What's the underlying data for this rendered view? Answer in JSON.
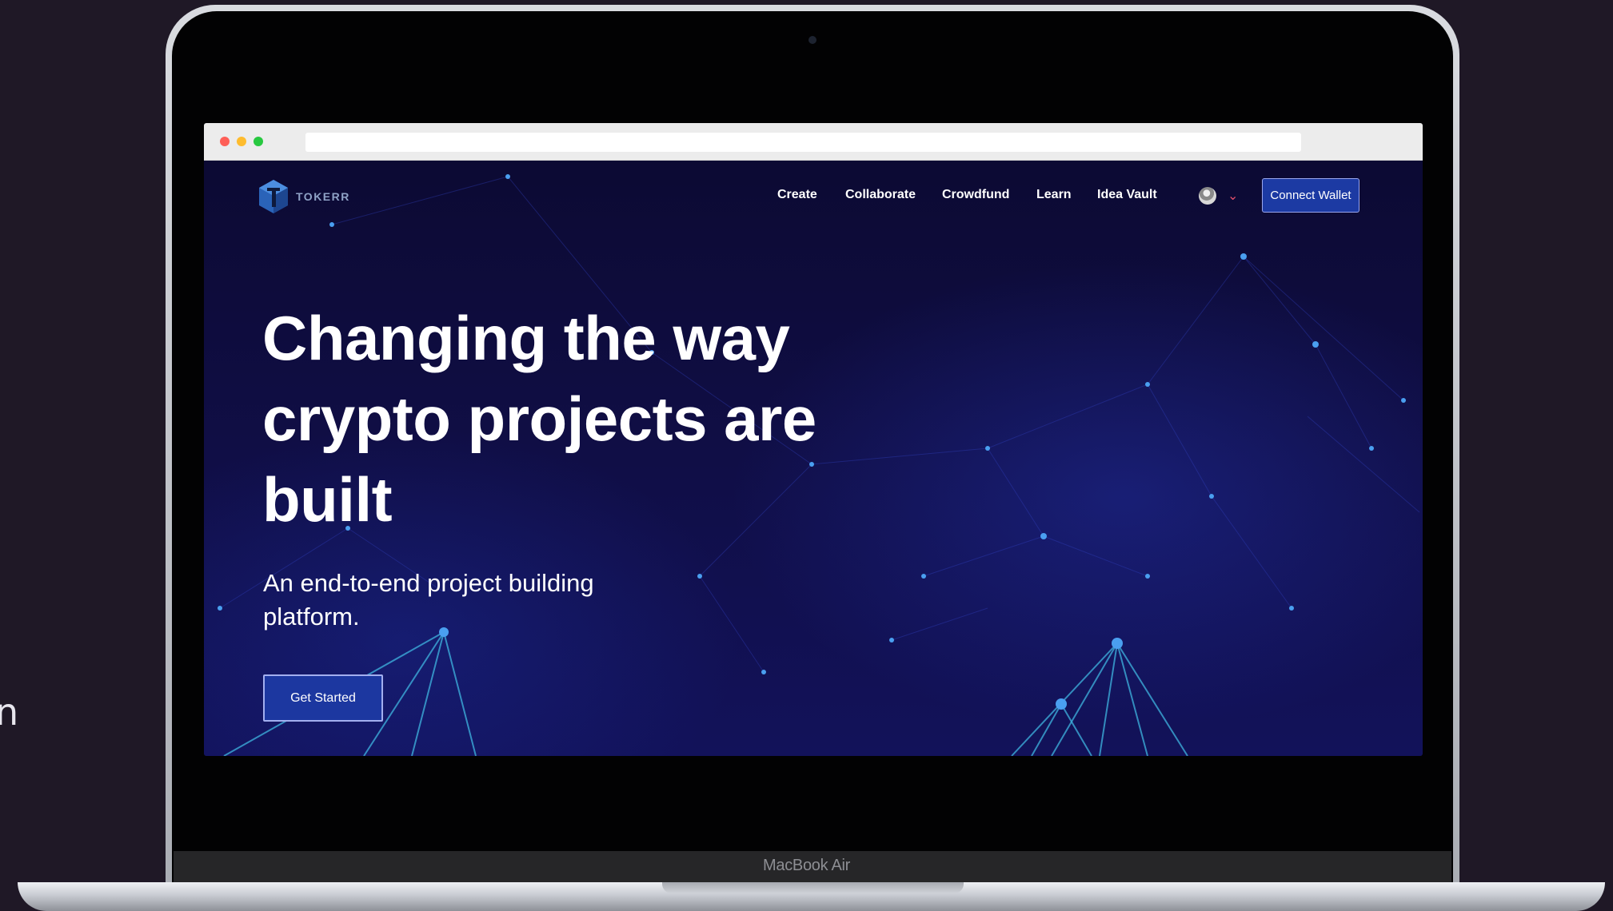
{
  "device": {
    "model_label": "MacBook Air"
  },
  "edge_text": "n",
  "browser": {
    "address_value": ""
  },
  "site": {
    "logo_text": "TOKERR",
    "nav": [
      "Create",
      "Collaborate",
      "Crowdfund",
      "Learn",
      "Idea Vault"
    ],
    "connect_wallet": "Connect Wallet",
    "hero": {
      "title": "Changing the way crypto projects are built",
      "subtitle": "An end-to-end project building platform.",
      "cta": "Get Started"
    }
  },
  "colors": {
    "page_bg": "#1f1826",
    "hero_bg": "#0c0a33",
    "button_blue": "#1c3aa3",
    "chevron": "#e2506c",
    "logo_text": "#8fa2c6"
  },
  "icons": {
    "logo": "hexagon-t-logo",
    "account": "avatar-icon",
    "dropdown": "chevron-down-icon",
    "window_controls": [
      "close-dot",
      "minimize-dot",
      "maximize-dot"
    ]
  }
}
